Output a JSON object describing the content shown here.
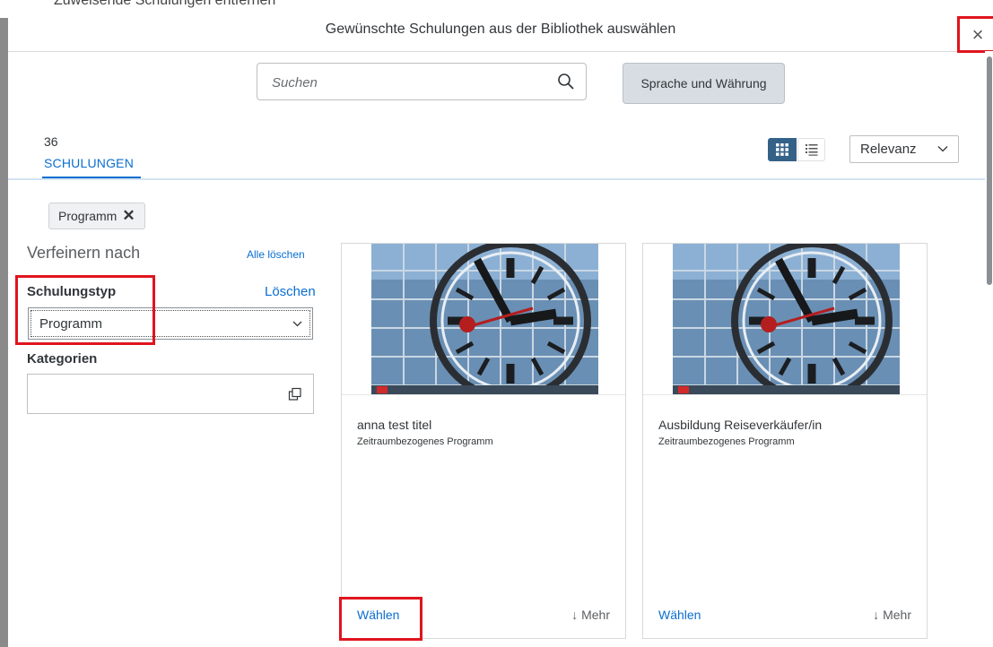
{
  "background_page": {
    "title": "Zuweisende Schulungen entfernen"
  },
  "dialog": {
    "title": "Gewünschte Schulungen aus der Bibliothek auswählen",
    "close_symbol": "×"
  },
  "search": {
    "placeholder": "Suchen",
    "value": ""
  },
  "language_button": {
    "label": "Sprache und Währung"
  },
  "tab": {
    "count": "36",
    "label": "SCHULUNGEN"
  },
  "sort": {
    "value": "Relevanz"
  },
  "filter_chip": {
    "label": "Programm",
    "remove_symbol": "✕"
  },
  "refine": {
    "title": "Verfeinern nach",
    "clear_all": "Alle löschen",
    "type_label": "Schulungstyp",
    "type_clear": "Löschen",
    "type_value": "Programm",
    "categories_label": "Kategorien",
    "categories_value": ""
  },
  "cards": [
    {
      "title": "anna test titel",
      "subtitle": "Zeitraumbezogenes Programm",
      "select_label": "Wählen",
      "more_label": "↓ Mehr"
    },
    {
      "title": "Ausbildung Reiseverkäufer/in",
      "subtitle": "Zeitraumbezogenes Programm",
      "select_label": "Wählen",
      "more_label": "↓ Mehr"
    }
  ],
  "colors": {
    "accent": "#0a6ed1",
    "highlight": "#e0141e",
    "view_active": "#346187"
  },
  "icons": [
    "search-icon",
    "grid-view-icon",
    "list-view-icon",
    "chevron-down-icon",
    "value-help-icon",
    "close-icon"
  ]
}
